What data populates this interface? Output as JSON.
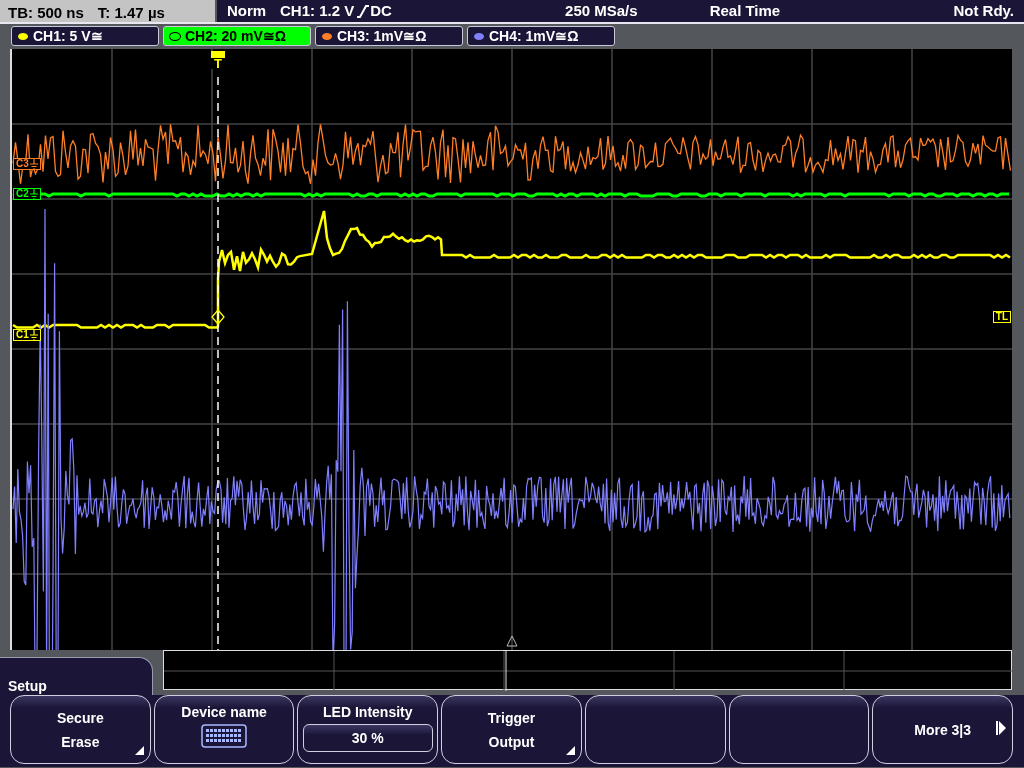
{
  "header": {
    "timebase": "TB: 500 ns",
    "trigger_time": "T: 1.47 µs",
    "trigger_mode": "Norm",
    "trigger_level": "CH1: 1.2 V",
    "trigger_coupling": "DC",
    "sample_rate": "250 MSa/s",
    "acquisition_mode": "Real Time",
    "status": "Not Rdy."
  },
  "channels": [
    {
      "label": "CH1: 5 V≅",
      "selected": false,
      "color": "#ffff00"
    },
    {
      "label": "CH2: 20 mV≅Ω",
      "selected": true,
      "color": "#00ff00"
    },
    {
      "label": "CH3: 1mV≅Ω",
      "selected": false,
      "color": "#ff7f27"
    },
    {
      "label": "CH4: 1mV≅Ω",
      "selected": false,
      "color": "#8080ff"
    }
  ],
  "markers": [
    {
      "label": "C3",
      "color": "#ff7f27"
    },
    {
      "label": "C2",
      "color": "#00ff00"
    },
    {
      "label": "C1",
      "color": "#ffff00"
    }
  ],
  "trigger_level_marker": "TL",
  "trigger_marker": "T",
  "menu": {
    "title": "Setup",
    "softkeys": [
      {
        "kind": "submenu",
        "lines": [
          "Secure",
          "Erase"
        ]
      },
      {
        "kind": "keyboard",
        "label": "Device name"
      },
      {
        "kind": "value",
        "label": "LED Intensity",
        "value": "30 %"
      },
      {
        "kind": "submenu",
        "lines": [
          "Trigger",
          "Output"
        ]
      },
      {
        "kind": "empty"
      },
      {
        "kind": "empty"
      },
      {
        "kind": "next",
        "label": "More 3|3"
      }
    ]
  }
}
